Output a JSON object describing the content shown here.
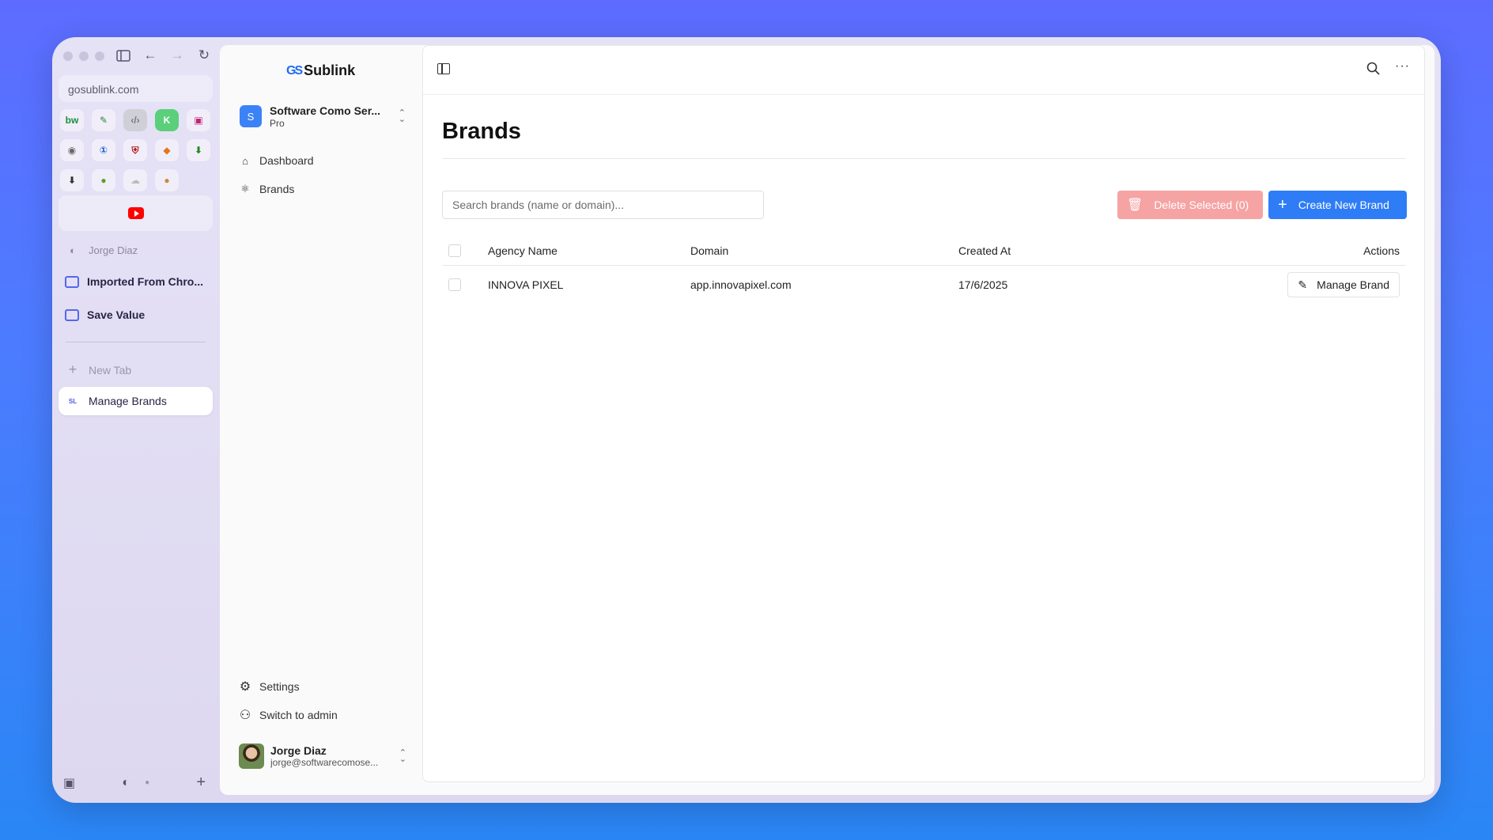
{
  "browser": {
    "url": "gosublink.com",
    "favicons": [
      "bw",
      "pen",
      "code",
      "K",
      "screen",
      "camera",
      "1password",
      "shield",
      "fox",
      "download",
      "download-box",
      "apple",
      "cloud",
      "cookie"
    ],
    "pinned_tab_icon": "youtube-icon",
    "profile_name": "Jorge Diaz",
    "folders": [
      "Imported From Chro...",
      "Save Value"
    ],
    "new_tab_label": "New Tab",
    "active_tab": {
      "label": "Manage Brands",
      "favicon_text": "SL"
    }
  },
  "app": {
    "logo_text": "Sublink",
    "logo_mark": "GS",
    "team": {
      "initial": "S",
      "name": "Software Como Ser...",
      "plan": "Pro"
    },
    "nav": [
      {
        "label": "Dashboard",
        "icon": "home-icon"
      },
      {
        "label": "Brands",
        "icon": "atom-icon"
      }
    ],
    "bottom_nav": [
      {
        "label": "Settings",
        "icon": "gear-icon"
      },
      {
        "label": "Switch to admin",
        "icon": "user-cog-icon"
      }
    ],
    "user": {
      "name": "Jorge Diaz",
      "email": "jorge@softwarecomose..."
    }
  },
  "page": {
    "title": "Brands",
    "search_placeholder": "Search brands (name or domain)...",
    "delete_label": "Delete Selected (0)",
    "create_label": "Create New Brand",
    "table": {
      "headers": [
        "Agency Name",
        "Domain",
        "Created At",
        "Actions"
      ],
      "rows": [
        {
          "name": "INNOVA PIXEL",
          "domain": "app.innovapixel.com",
          "created": "17/6/2025",
          "action": "Manage Brand"
        }
      ]
    }
  },
  "colors": {
    "primary": "#2f7df6",
    "danger_disabled": "#f6a3a3",
    "accent_folder": "#5468e8"
  }
}
